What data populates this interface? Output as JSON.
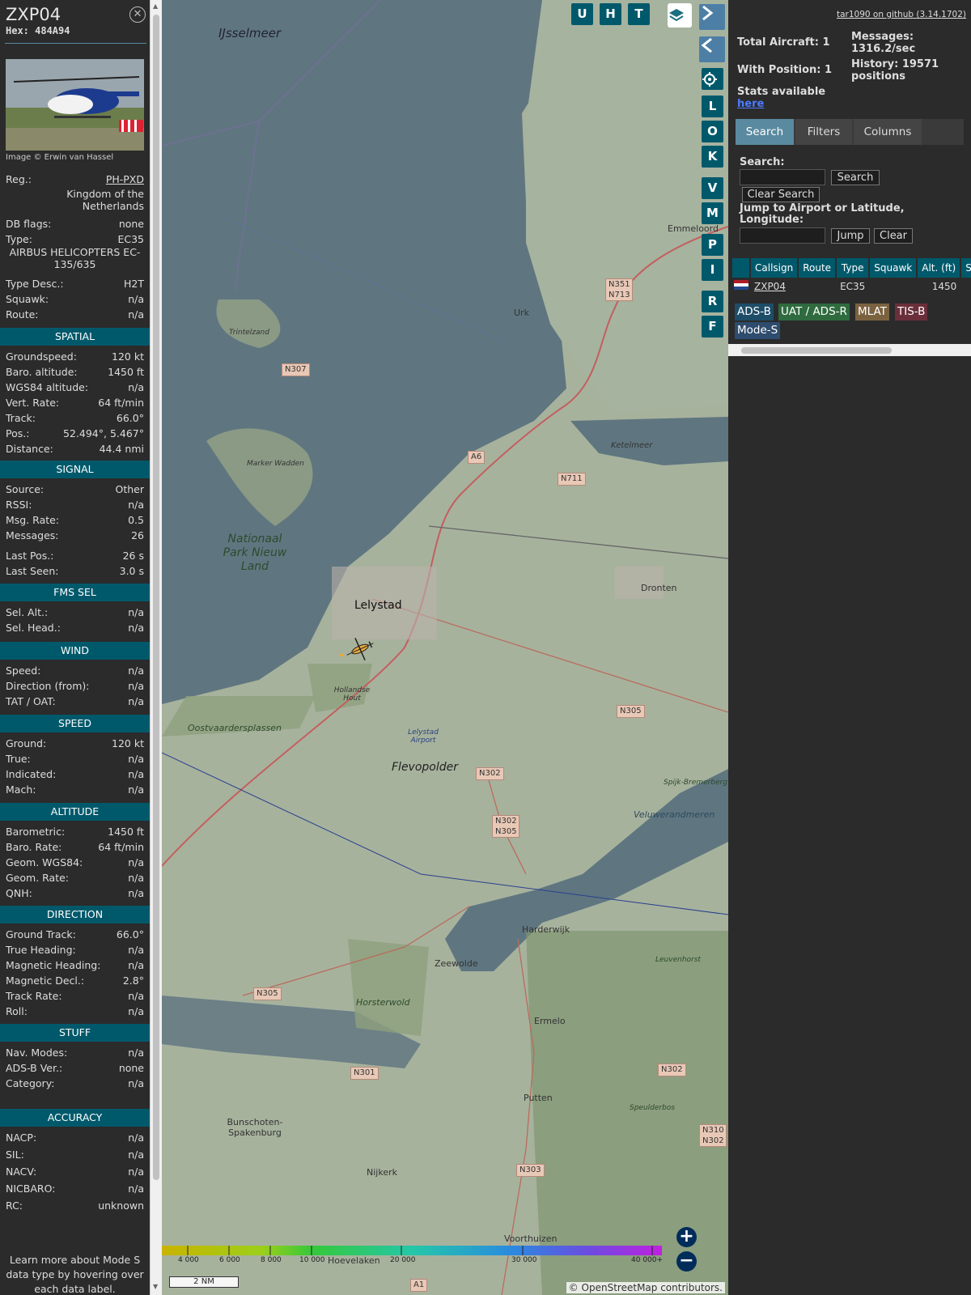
{
  "selected": {
    "callsign": "ZXP04",
    "hex_label": "Hex: 484A94",
    "close_icon": "close-icon",
    "photo_credit": "Image © Erwin van Hassel",
    "basic": [
      {
        "k": "Reg.:",
        "v": "PH-PXD"
      },
      {
        "k": "",
        "v": "Kingdom of the Netherlands"
      },
      {
        "k": "DB flags:",
        "v": "none"
      },
      {
        "k": "Type:",
        "v": "EC35"
      },
      {
        "k": "",
        "v": "AIRBUS HELICOPTERS EC-135/635"
      },
      {
        "k": "Type Desc.:",
        "v": "H2T"
      },
      {
        "k": "Squawk:",
        "v": "n/a"
      },
      {
        "k": "Route:",
        "v": "n/a"
      }
    ],
    "sections": [
      {
        "title": "SPATIAL",
        "rows": [
          {
            "k": "Groundspeed:",
            "v": "120 kt"
          },
          {
            "k": "Baro. altitude:",
            "v": "1450 ft"
          },
          {
            "k": "WGS84 altitude:",
            "v": "n/a"
          },
          {
            "k": "Vert. Rate:",
            "v": "64 ft/min"
          },
          {
            "k": "Track:",
            "v": "66.0°"
          },
          {
            "k": "Pos.:",
            "v": "52.494°, 5.467°"
          },
          {
            "k": "Distance:",
            "v": "44.4 nmi"
          }
        ]
      },
      {
        "title": "SIGNAL",
        "rows": [
          {
            "k": "Source:",
            "v": "Other"
          },
          {
            "k": "RSSI:",
            "v": "n/a"
          },
          {
            "k": "Msg. Rate:",
            "v": "0.5"
          },
          {
            "k": "Messages:",
            "v": "26"
          },
          {
            "k": "Last Pos.:",
            "v": "26 s"
          },
          {
            "k": "Last Seen:",
            "v": "3.0 s"
          }
        ]
      },
      {
        "title": "FMS SEL",
        "rows": [
          {
            "k": "Sel. Alt.:",
            "v": "n/a"
          },
          {
            "k": "Sel. Head.:",
            "v": "n/a"
          }
        ]
      },
      {
        "title": "WIND",
        "rows": [
          {
            "k": "Speed:",
            "v": "n/a"
          },
          {
            "k": "Direction (from):",
            "v": "n/a"
          },
          {
            "k": "TAT / OAT:",
            "v": "n/a"
          }
        ]
      },
      {
        "title": "SPEED",
        "rows": [
          {
            "k": "Ground:",
            "v": "120 kt"
          },
          {
            "k": "True:",
            "v": "n/a"
          },
          {
            "k": "Indicated:",
            "v": "n/a"
          },
          {
            "k": "Mach:",
            "v": "n/a"
          }
        ]
      },
      {
        "title": "ALTITUDE",
        "rows": [
          {
            "k": "Barometric:",
            "v": "1450 ft"
          },
          {
            "k": "Baro. Rate:",
            "v": "64 ft/min"
          },
          {
            "k": "Geom. WGS84:",
            "v": "n/a"
          },
          {
            "k": "Geom. Rate:",
            "v": "n/a"
          },
          {
            "k": "QNH:",
            "v": "n/a"
          }
        ]
      },
      {
        "title": "DIRECTION",
        "rows": [
          {
            "k": "Ground Track:",
            "v": "66.0°"
          },
          {
            "k": "True Heading:",
            "v": "n/a"
          },
          {
            "k": "Magnetic Heading:",
            "v": "n/a"
          },
          {
            "k": "Magnetic Decl.:",
            "v": "2.8°"
          },
          {
            "k": "Track Rate:",
            "v": "n/a"
          },
          {
            "k": "Roll:",
            "v": "n/a"
          }
        ]
      },
      {
        "title": "STUFF",
        "rows": [
          {
            "k": "Nav. Modes:",
            "v": "n/a"
          },
          {
            "k": "ADS-B Ver.:",
            "v": "none"
          },
          {
            "k": "Category:",
            "v": "n/a"
          }
        ]
      },
      {
        "title": "ACCURACY",
        "rows": [
          {
            "k": "NACP:",
            "v": "n/a"
          },
          {
            "k": "SIL:",
            "v": "n/a"
          },
          {
            "k": "NACV:",
            "v": "n/a"
          },
          {
            "k": "NICBARO:",
            "v": "n/a"
          },
          {
            "k": "RC:",
            "v": "unknown"
          }
        ]
      }
    ],
    "learn_more": "Learn more about Mode S data type by hovering over each data label."
  },
  "map": {
    "place_labels": [
      "IJsselmeer",
      "Emmeloord",
      "Urk",
      "Trintelzand",
      "Ketelmeer",
      "Marker Wadden",
      "Nationaal Park Nieuw Land",
      "Lelystad",
      "Dronten",
      "Hollandse Hout",
      "Oostvaardersplassen",
      "Lelystad Airport",
      "Flevopolder",
      "Spijk-Bremerberg",
      "Veluwerandmeren",
      "Harderwijk",
      "Zeewolde",
      "Horsterwold",
      "Leuvenhorst",
      "Ermelo",
      "Putten",
      "Bunschoten-Spakenburg",
      "Nijkerk",
      "Voorthuizen",
      "Hoevelaken",
      "Speulderbos"
    ],
    "road_labels": [
      "N307",
      "N351 N713",
      "A6",
      "N711",
      "N305",
      "N302",
      "N302 N305",
      "N305",
      "N301",
      "N303",
      "N302",
      "N310 N302",
      "A1"
    ],
    "buttons": [
      "U",
      "H",
      "T"
    ],
    "side_buttons": [
      "L",
      "O",
      "K",
      "V",
      "M",
      "P",
      "I",
      "R",
      "F"
    ],
    "altitude_legend": [
      "4 000",
      "6 000",
      "8 000",
      "10 000",
      "20 000",
      "30 000",
      "40 000+"
    ],
    "scale": "2 NM",
    "attribution": "© OpenStreetMap contributors.",
    "zoom_in": "+",
    "zoom_out": "−",
    "layers_icon": "layers-icon",
    "settings_icon": "gear-icon"
  },
  "sidebar": {
    "github": "tar1090 on github (3.14.1702)",
    "total_aircraft": "Total Aircraft: 1",
    "with_position": "With Position: 1",
    "messages": "Messages: 1316.2/sec",
    "history": "History: 19571 positions",
    "stats_label": "Stats available",
    "stats_link": "here",
    "tabs": [
      "Search",
      "Filters",
      "Columns"
    ],
    "search_label": "Search:",
    "search_button": "Search",
    "clear_search_button": "Clear Search",
    "jump_label": "Jump to Airport or Latitude, Longitude:",
    "jump_button": "Jump",
    "clear_button": "Clear",
    "table": {
      "headers": [
        "Callsign",
        "Route",
        "Type",
        "Squawk",
        "Alt. (ft)",
        "Spd."
      ],
      "rows": [
        {
          "callsign": "ZXP04",
          "route": "",
          "type": "EC35",
          "squawk": "",
          "alt": "1450",
          "spd": ""
        }
      ]
    },
    "source_chips": [
      "ADS-B",
      "UAT / ADS-R",
      "MLAT",
      "TIS-B",
      "Mode-S"
    ],
    "colors": {
      "accent": "#00596b",
      "adsb": "#1e4d68",
      "uat": "#2f6b3e",
      "mlat": "#7a6240",
      "tisb": "#6a2f3a",
      "modes": "#2e4c6d"
    }
  }
}
